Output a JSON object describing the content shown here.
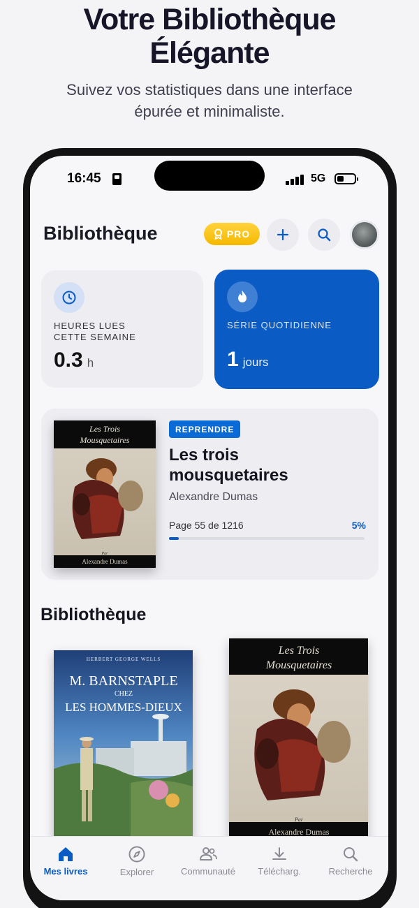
{
  "hero": {
    "title_line1": "Votre Bibliothèque",
    "title_line2": "Élégante",
    "subtitle_line1": "Suivez vos statistiques dans une interface",
    "subtitle_line2": "épurée et minimaliste."
  },
  "status_bar": {
    "time": "16:45",
    "network": "5G"
  },
  "header": {
    "title": "Bibliothèque",
    "pro_label": "PRO"
  },
  "stats": {
    "hours": {
      "label_line1": "HEURES LUES",
      "label_line2": "CETTE SEMAINE",
      "value": "0.3",
      "unit": "h"
    },
    "streak": {
      "label": "SÉRIE QUOTIDIENNE",
      "value": "1",
      "unit": "jours"
    }
  },
  "current_book": {
    "badge": "REPRENDRE",
    "title_line1": "Les trois",
    "title_line2": "mousquetaires",
    "author": "Alexandre Dumas",
    "progress_text": "Page 55 de 1216",
    "progress_percent_label": "5%",
    "progress_fraction": 0.05,
    "cover_title_line1": "Les Trois",
    "cover_title_line2": "Mousquetaires",
    "cover_by": "Par",
    "cover_author": "Alexandre Dumas"
  },
  "library": {
    "title": "Bibliothèque",
    "books": [
      {
        "cover_author": "HERBERT GEORGE WELLS",
        "cover_title_line1": "M. BARNSTAPLE",
        "cover_title_line2": "CHEZ",
        "cover_title_line3": "LES HOMMES-DIEUX"
      },
      {
        "cover_title_line1": "Les Trois",
        "cover_title_line2": "Mousquetaires",
        "cover_by": "Par",
        "cover_author": "Alexandre Dumas"
      }
    ]
  },
  "tabs": [
    {
      "label": "Mes livres",
      "icon": "home-icon",
      "active": true
    },
    {
      "label": "Explorer",
      "icon": "compass-icon",
      "active": false
    },
    {
      "label": "Communauté",
      "icon": "people-icon",
      "active": false
    },
    {
      "label": "Télécharg.",
      "icon": "download-icon",
      "active": false
    },
    {
      "label": "Recherche",
      "icon": "search-icon",
      "active": false
    }
  ],
  "colors": {
    "accent": "#0a5bc4",
    "pro": "#f5b800"
  }
}
